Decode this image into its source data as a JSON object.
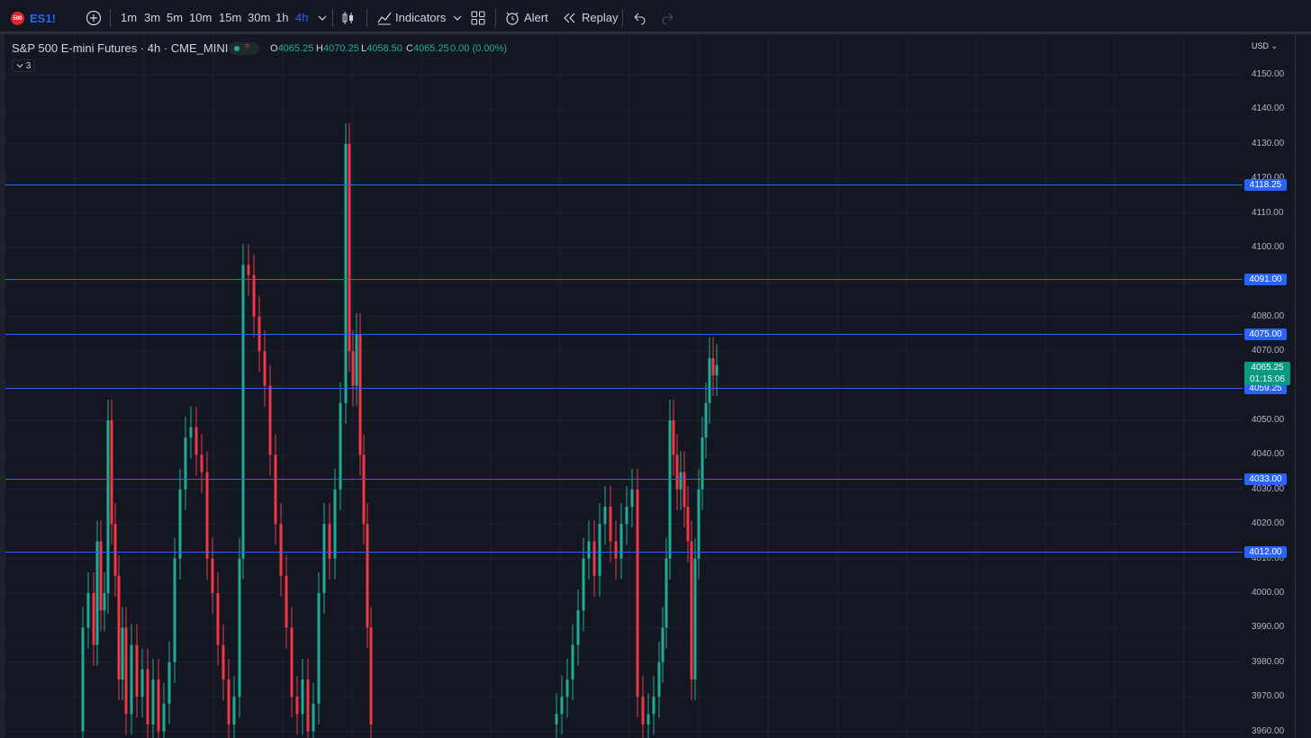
{
  "toolbar": {
    "symbol_badge": "500",
    "symbol": "ES1!",
    "intervals": [
      "1m",
      "3m",
      "5m",
      "10m",
      "15m",
      "30m",
      "1h",
      "4h"
    ],
    "active_interval": "4h",
    "indicators_label": "Indicators",
    "alert_label": "Alert",
    "replay_label": "Replay"
  },
  "legend": {
    "title": "S&P 500 E-mini Futures · 4h · CME_MINI",
    "open_key": "O",
    "open": "4065.25",
    "high_key": "H",
    "high": "4070.25",
    "low_key": "L",
    "low": "4058.50",
    "close_key": "C",
    "close": "4065.25",
    "change": "0.00 (0.00%)",
    "indicator_count": "3"
  },
  "price_axis": {
    "currency": "USD",
    "ticks": [
      "4150.00",
      "4140.00",
      "4130.00",
      "4120.00",
      "4110.00",
      "4100.00",
      "4090.00",
      "4080.00",
      "4070.00",
      "4060.00",
      "4050.00",
      "4040.00",
      "4030.00",
      "4020.00",
      "4010.00",
      "4000.00",
      "3990.00",
      "3980.00",
      "3970.00",
      "3960.00"
    ]
  },
  "horizontal_lines": [
    "4118.25",
    "4091.00",
    "4075.00",
    "4059.25",
    "4033.00",
    "4012.00"
  ],
  "last_price": {
    "value": "4065.25",
    "countdown": "01:15:06"
  },
  "colors": {
    "up": "#22ab94",
    "down": "#f23645",
    "line": "#2962ff",
    "background": "#131722"
  }
}
